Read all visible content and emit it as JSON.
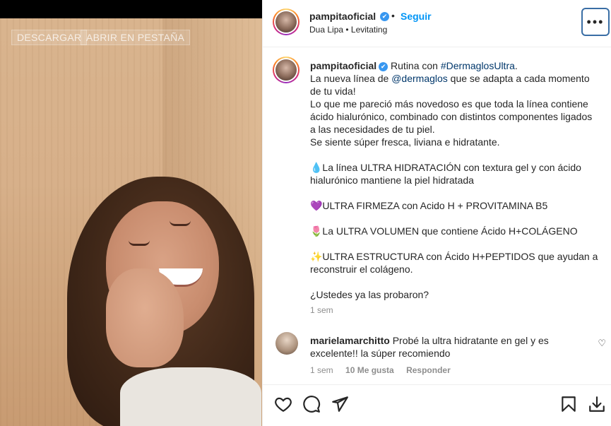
{
  "media": {
    "buttons": {
      "download": "DESCARGAR",
      "open_tab": "ABRIR EN PESTAÑA"
    }
  },
  "header": {
    "username": "pampitaoficial",
    "verified_icon": "✔",
    "separator": "•",
    "follow": "Seguir",
    "song": "Dua Lipa • Levitating",
    "more_icon": "•••"
  },
  "caption": {
    "username": "pampitaoficial",
    "lines": {
      "l1_pre": " Rutina con ",
      "l1_hash": "#DermaglosUltra",
      "l1_post": ".",
      "l2_pre": "La nueva línea de ",
      "l2_mention": "@dermaglos",
      "l2_post": " que se adapta a cada momento de tu vida!",
      "l3": "Lo que me pareció más novedoso es que toda la línea contiene ácido hialurónico, combinado con distintos componentes ligados a las necesidades de tu piel.",
      "l4": "Se siente súper fresca, liviana e hidratante.",
      "p1": "💧La línea ULTRA HIDRATACIÓN con textura gel y con ácido hialurónico mantiene la piel hidratada",
      "p2": "💜ULTRA FIRMEZA con Acido H + PROVITAMINA B5",
      "p3": "🌷La ULTRA VOLUMEN que contiene Ácido H+COLÁGENO",
      "p4": "✨ULTRA ESTRUCTURA con Ácido H+PEPTIDOS que ayudan a reconstruir el colágeno.",
      "p5": "¿Ustedes ya las probaron?"
    },
    "time": "1 sem"
  },
  "comment": {
    "username": "marielamarchitto",
    "text": " Probé la ultra hidratante en gel y es excelente!! la súper recomiendo",
    "time": "1 sem",
    "likes": "10 Me gusta",
    "reply": "Responder",
    "heart_icon": "♡"
  },
  "actions": {
    "icons": [
      "heart-icon",
      "comment-icon",
      "share-icon",
      "bookmark-icon",
      "download-icon"
    ]
  }
}
